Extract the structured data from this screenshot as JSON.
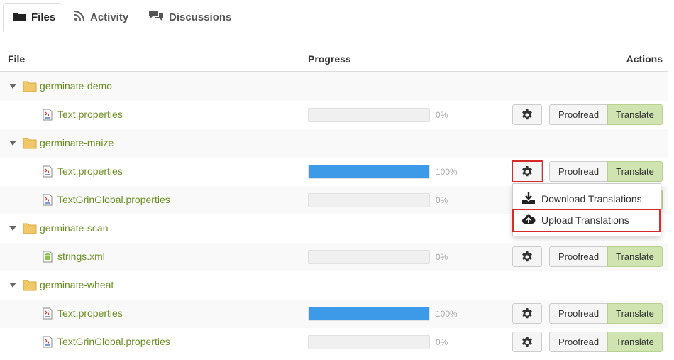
{
  "tabs": [
    {
      "label": "Files",
      "icon": "folder-icon",
      "active": true
    },
    {
      "label": "Activity",
      "icon": "rss-icon",
      "active": false
    },
    {
      "label": "Discussions",
      "icon": "comments-icon",
      "active": false
    }
  ],
  "table": {
    "headers": {
      "file": "File",
      "progress": "Progress",
      "actions": "Actions"
    },
    "rows": [
      {
        "type": "folder",
        "name": "germinate-demo"
      },
      {
        "type": "file",
        "name": "Text.properties",
        "icon": "java-file-icon",
        "progress": 0,
        "progress_label": "0%"
      },
      {
        "type": "folder",
        "name": "germinate-maize"
      },
      {
        "type": "file",
        "name": "Text.properties",
        "icon": "java-file-icon",
        "progress": 100,
        "progress_label": "100%"
      },
      {
        "type": "file",
        "name": "TextGrinGlobal.properties",
        "icon": "java-file-icon",
        "progress": 0,
        "progress_label": "0%"
      },
      {
        "type": "folder",
        "name": "germinate-scan"
      },
      {
        "type": "file",
        "name": "strings.xml",
        "icon": "android-file-icon",
        "progress": 0,
        "progress_label": "0%"
      },
      {
        "type": "folder",
        "name": "germinate-wheat"
      },
      {
        "type": "file",
        "name": "Text.properties",
        "icon": "java-file-icon",
        "progress": 100,
        "progress_label": "100%"
      },
      {
        "type": "file",
        "name": "TextGrinGlobal.properties",
        "icon": "java-file-icon",
        "progress": 0,
        "progress_label": "0%"
      }
    ],
    "actions": {
      "proofread": "Proofread",
      "translate": "Translate"
    }
  },
  "dropdown": {
    "items": [
      {
        "label": "Download Translations",
        "icon": "download-icon"
      },
      {
        "label": "Upload Translations",
        "icon": "cloud-upload-icon"
      }
    ]
  },
  "colors": {
    "link": "#6b8e23",
    "progress_fill": "#3d9ae8",
    "translate_bg": "#cfe4b0",
    "highlight": "#d62b2b"
  }
}
